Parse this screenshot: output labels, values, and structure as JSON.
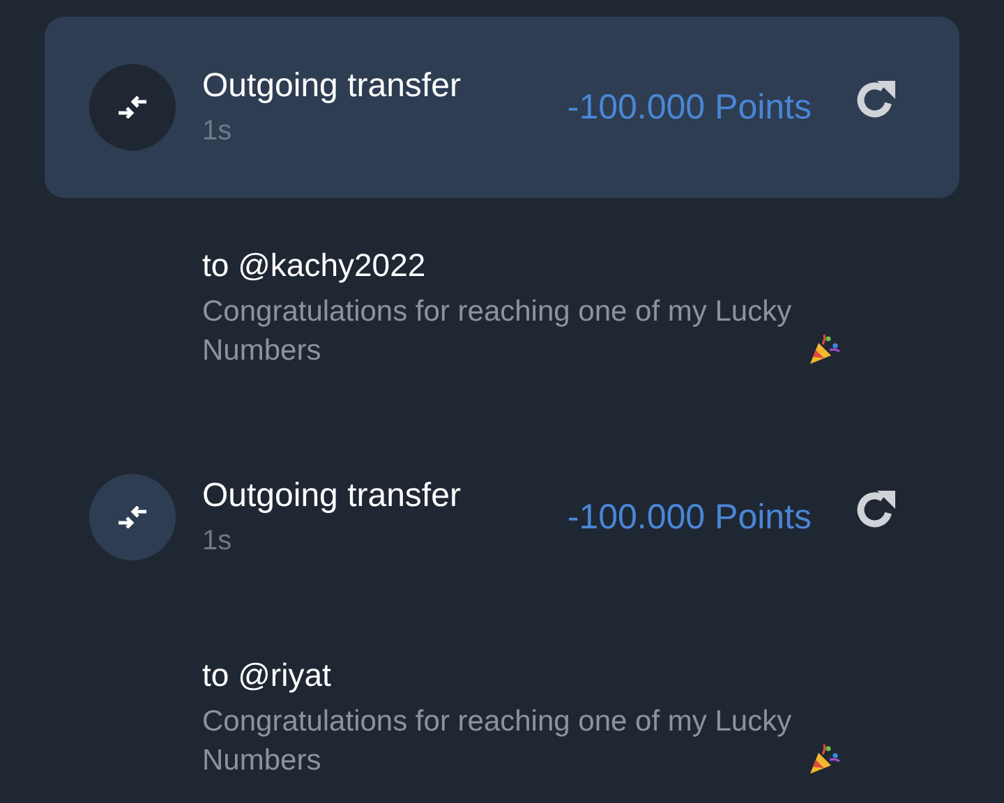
{
  "transactions": [
    {
      "title": "Outgoing transfer",
      "time": "1s",
      "amount": "-100.000 Points",
      "selected": true,
      "recipient": "to @kachy2022",
      "message": "Congratulations for reaching one of my Lucky Numbers"
    },
    {
      "title": "Outgoing transfer",
      "time": "1s",
      "amount": "-100.000 Points",
      "selected": false,
      "recipient": "to @riyat",
      "message": "Congratulations for reaching one of my Lucky Numbers"
    }
  ]
}
